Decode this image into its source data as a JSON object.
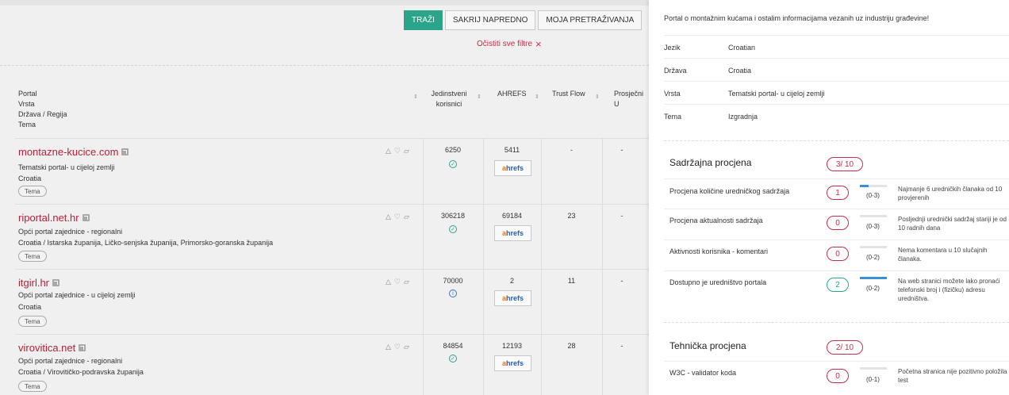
{
  "toolbar": {
    "search_label": "TRAŽI",
    "hide_advanced_label": "SAKRIJ NAPREDNO",
    "my_searches_label": "MOJA PRETRAŽIVANJA",
    "clear_filters_label": "Očistiti sve filtre",
    "clear_icon": "×"
  },
  "table": {
    "header_portal": [
      "Portal",
      "Vrsta",
      "Država / Regija",
      "Tema"
    ],
    "header_unique": [
      "Jedinstveni",
      "korisnici"
    ],
    "header_ahrefs": "AHREFS",
    "header_trust": "Trust Flow",
    "header_avg": "Prosječni U",
    "sort_icon": "⇕",
    "rows": [
      {
        "name": "montazne-kucice.com",
        "type": "Tematski portal- u cijeloj zemlji",
        "region": "Croatia",
        "tag": "Tema",
        "users": "6250",
        "users_status": "check",
        "ahrefs": "5411",
        "trust": "-",
        "avg": "-"
      },
      {
        "name": "riportal.net.hr",
        "type": "Opći portal zajednice - regionalni",
        "region": "Croatia / Istarska županija, Ličko-senjska županija, Primorsko-goranska županija",
        "tag": "Tema",
        "users": "306218",
        "users_status": "check",
        "ahrefs": "69184",
        "trust": "23",
        "avg": "-"
      },
      {
        "name": "itgirl.hr",
        "type": "Opći portal zajednice - u cijeloj zemlji",
        "region": "Croatia",
        "tag": "Tema",
        "users": "70000",
        "users_status": "info",
        "ahrefs": "2",
        "trust": "11",
        "avg": "-"
      },
      {
        "name": "virovitica.net",
        "type": "Opći portal zajednice - regionalni",
        "region": "Croatia / Virovitičko-podravska županija",
        "tag": "Tema",
        "users": "84854",
        "users_status": "check",
        "ahrefs": "12193",
        "trust": "28",
        "avg": "-"
      }
    ],
    "ahrefs_logo_a": "a",
    "ahrefs_logo_rest": "hrefs"
  },
  "panel": {
    "description": "Portal o montažnim kućama i ostalim informacijama vezanih uz industriju građevine!",
    "info": [
      {
        "label": "Jezik",
        "value": "Croatian"
      },
      {
        "label": "Država",
        "value": "Croatia"
      },
      {
        "label": "Vrsta",
        "value": "Tematski portal- u cijeloj zemlji"
      },
      {
        "label": "Tema",
        "value": "Izgradnja"
      }
    ],
    "content_section": {
      "title": "Sadržajna procjena",
      "score": "3/ 10",
      "items": [
        {
          "label": "Procjena količine uredničkog sadržaja",
          "score": "1",
          "range": "(0-3)",
          "fill": 0.33,
          "note": "Najmanje 6 uredničkih članaka od 10 provjerenih"
        },
        {
          "label": "Procjena aktualnosti sadržaja",
          "score": "0",
          "range": "(0-3)",
          "fill": 0,
          "note": "Posljednji urednički sadržaj stariji je od 10 radnih dana"
        },
        {
          "label": "Aktivnosti korisnika - komentari",
          "score": "0",
          "range": "(0-2)",
          "fill": 0,
          "note": "Nema komentara u 10 slučajnih članaka."
        },
        {
          "label": "Dostupno je uredništvo portala",
          "score": "2",
          "range": "(0-2)",
          "fill": 1,
          "note": "Na web stranici možete lako pronaći telefonski broj i (fizičku) adresu uredništva."
        }
      ]
    },
    "tech_section": {
      "title": "Tehnička procjena",
      "score": "2/ 10",
      "items": [
        {
          "label": "W3C - validator koda",
          "score": "0",
          "range": "(0-1)",
          "fill": 0,
          "note": "Početna stranica nije pozitivno položila test"
        }
      ]
    }
  },
  "colors": {
    "accent_green": "#2aa58a",
    "link_red": "#b0233c",
    "bar_blue": "#3b8fd4"
  }
}
